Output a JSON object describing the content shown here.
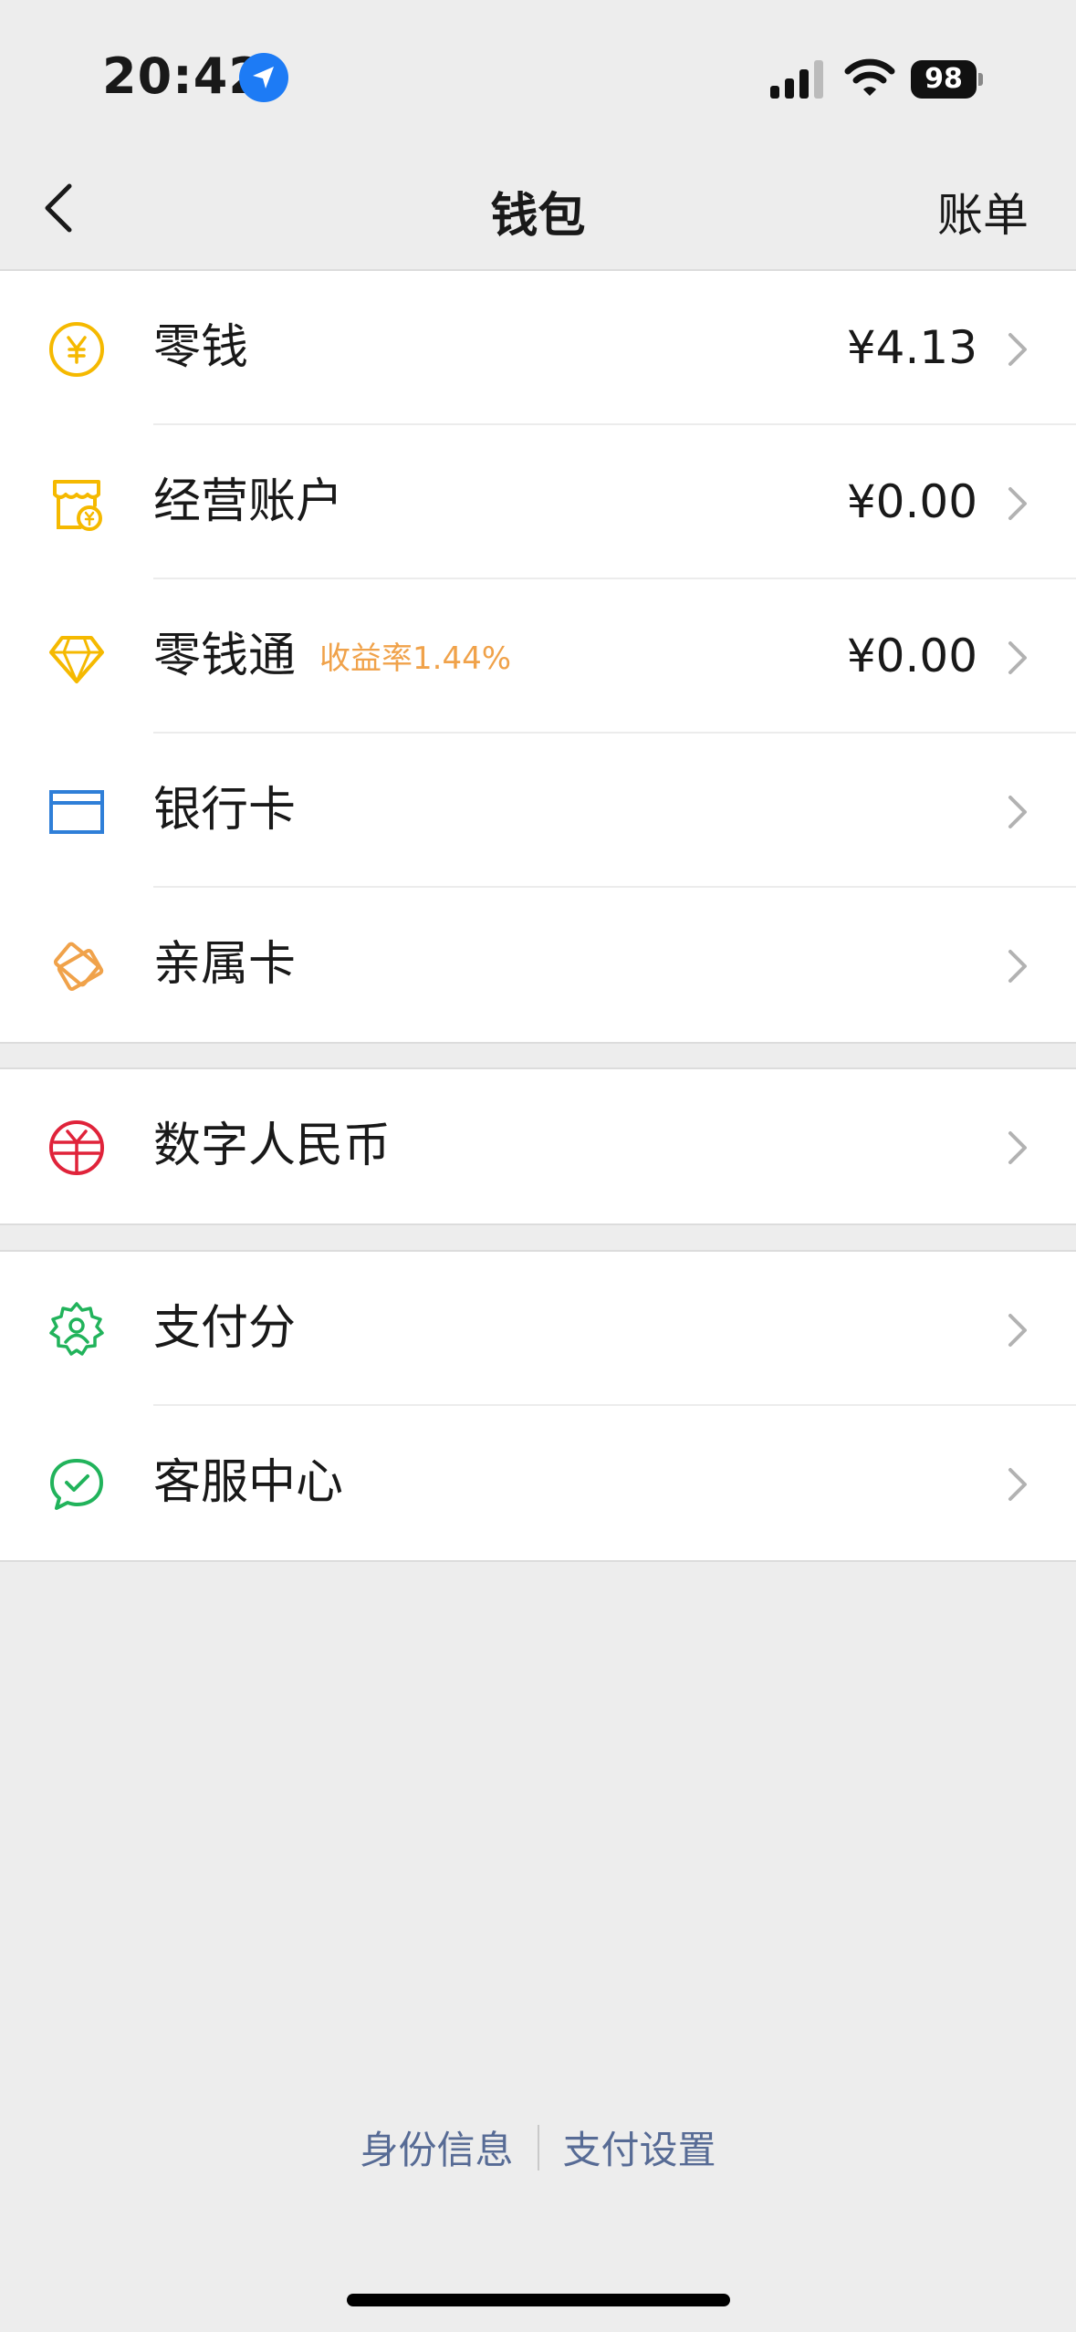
{
  "status_bar": {
    "time": "20:42",
    "battery": "98"
  },
  "nav": {
    "title": "钱包",
    "right_action": "账单"
  },
  "items": [
    {
      "label": "零钱",
      "value": "¥4.13",
      "icon": "coin-yuan-icon"
    },
    {
      "label": "经营账户",
      "value": "¥0.00",
      "icon": "storefront-icon"
    },
    {
      "label": "零钱通",
      "value": "¥0.00",
      "badge": "收益率1.44%",
      "icon": "diamond-icon"
    },
    {
      "label": "银行卡",
      "icon": "bank-card-icon"
    },
    {
      "label": "亲属卡",
      "icon": "family-card-icon"
    },
    {
      "label": "数字人民币",
      "icon": "digital-rmb-icon"
    },
    {
      "label": "支付分",
      "icon": "pay-score-icon"
    },
    {
      "label": "客服中心",
      "icon": "customer-service-icon"
    }
  ],
  "footer": {
    "identity": "身份信息",
    "pay_settings": "支付设置"
  },
  "colors": {
    "background": "#ededed",
    "yellow_icon": "#f5b900",
    "badge_orange": "#f0a24a",
    "blue_icon": "#2f7fd8",
    "red_icon": "#e0233a",
    "green_icon": "#21b35b",
    "link_blue": "#576b95",
    "location_blue": "#1d7bf5"
  }
}
